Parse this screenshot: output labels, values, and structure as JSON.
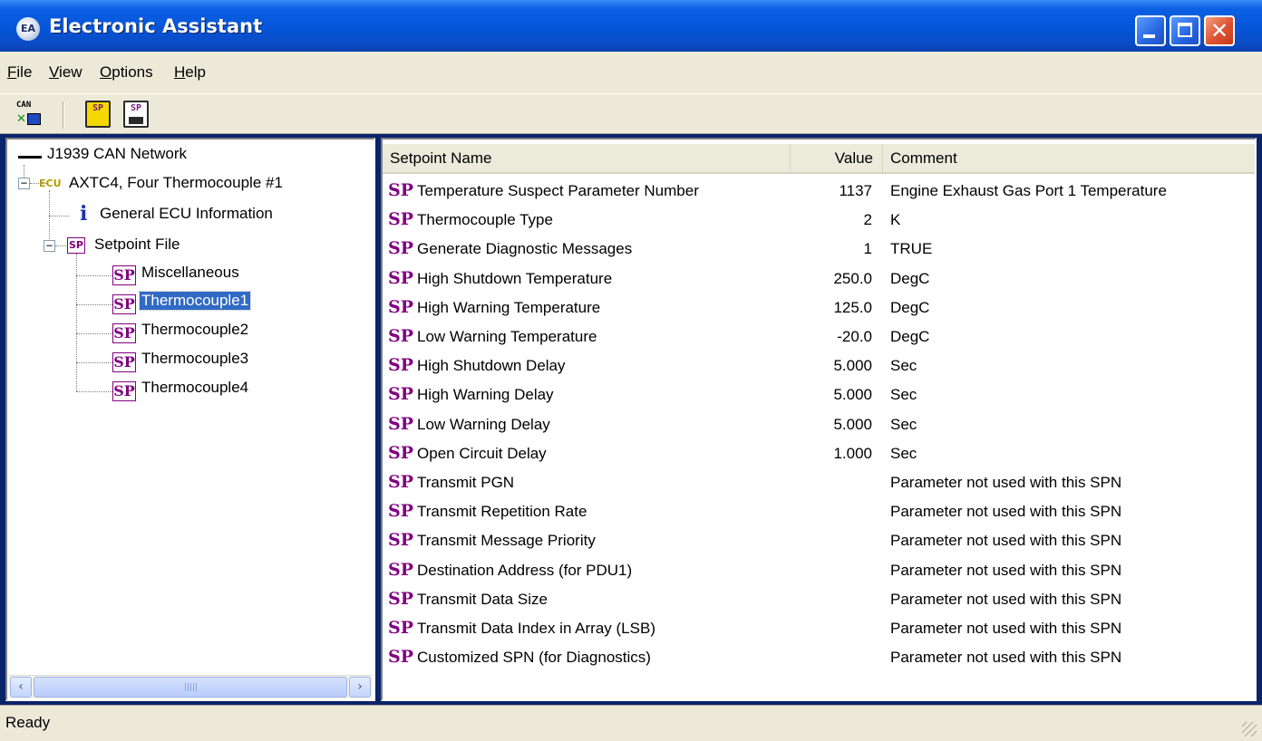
{
  "window": {
    "title": "Electronic Assistant",
    "app_icon_text": "EA",
    "controls": {
      "close_glyph": "✕"
    }
  },
  "menu": {
    "items": [
      {
        "label": "File",
        "accel": "F",
        "rest": "ile"
      },
      {
        "label": "View",
        "accel": "V",
        "rest": "iew"
      },
      {
        "label": "Options",
        "accel": "O",
        "rest": "ptions"
      },
      {
        "label": "Help",
        "accel": "H",
        "rest": "elp"
      }
    ]
  },
  "toolbar": {
    "buttons": [
      {
        "icon": "can-connect-icon",
        "text": "CAN"
      },
      {
        "icon": "open-setpoint-file-icon",
        "text": "SP"
      },
      {
        "icon": "save-setpoint-file-icon",
        "text": "SP"
      }
    ]
  },
  "tree": {
    "root": {
      "label": "J1939 CAN Network"
    },
    "ecu": {
      "icon_text": "ECU",
      "label": "AXTC4, Four Thermocouple #1",
      "toggle": "−"
    },
    "info": {
      "icon_text": "i",
      "label": "General ECU Information"
    },
    "setpoint_file": {
      "icon_text": "SP",
      "label": "Setpoint File",
      "toggle": "−"
    },
    "groups": [
      {
        "icon_text": "SP",
        "label": "Miscellaneous",
        "selected": false
      },
      {
        "icon_text": "SP",
        "label": "Thermocouple1",
        "selected": true
      },
      {
        "icon_text": "SP",
        "label": "Thermocouple2",
        "selected": false
      },
      {
        "icon_text": "SP",
        "label": "Thermocouple3",
        "selected": false
      },
      {
        "icon_text": "SP",
        "label": "Thermocouple4",
        "selected": false
      }
    ],
    "scrollbar": {
      "left_glyph": "‹",
      "right_glyph": "›"
    }
  },
  "table": {
    "sp_tag": "SP",
    "headers": {
      "name": "Setpoint Name",
      "value": "Value",
      "comment": "Comment"
    },
    "rows": [
      {
        "name": "Temperature Suspect Parameter Number",
        "value": "1137",
        "comment": "Engine Exhaust Gas Port 1 Temperature"
      },
      {
        "name": "Thermocouple Type",
        "value": "2",
        "comment": "K"
      },
      {
        "name": "Generate Diagnostic Messages",
        "value": "1",
        "comment": "TRUE"
      },
      {
        "name": "High Shutdown Temperature",
        "value": "250.0",
        "comment": "DegC"
      },
      {
        "name": "High Warning Temperature",
        "value": "125.0",
        "comment": "DegC"
      },
      {
        "name": "Low Warning Temperature",
        "value": "-20.0",
        "comment": "DegC"
      },
      {
        "name": "High Shutdown Delay",
        "value": "5.000",
        "comment": "Sec"
      },
      {
        "name": "High Warning Delay",
        "value": "5.000",
        "comment": "Sec"
      },
      {
        "name": "Low Warning Delay",
        "value": "5.000",
        "comment": "Sec"
      },
      {
        "name": "Open Circuit Delay",
        "value": "1.000",
        "comment": "Sec"
      },
      {
        "name": "Transmit PGN",
        "value": "",
        "comment": "Parameter not used with this SPN"
      },
      {
        "name": "Transmit Repetition Rate",
        "value": "",
        "comment": "Parameter not used with this SPN"
      },
      {
        "name": "Transmit Message Priority",
        "value": "",
        "comment": "Parameter not used with this SPN"
      },
      {
        "name": "Destination Address (for PDU1)",
        "value": "",
        "comment": "Parameter not used with this SPN"
      },
      {
        "name": "Transmit Data Size",
        "value": "",
        "comment": "Parameter not used with this SPN"
      },
      {
        "name": "Transmit Data Index in Array (LSB)",
        "value": "",
        "comment": "Parameter not used with this SPN"
      },
      {
        "name": "Customized SPN (for Diagnostics)",
        "value": "",
        "comment": "Parameter not used with this SPN"
      }
    ]
  },
  "status": {
    "text": "Ready"
  }
}
